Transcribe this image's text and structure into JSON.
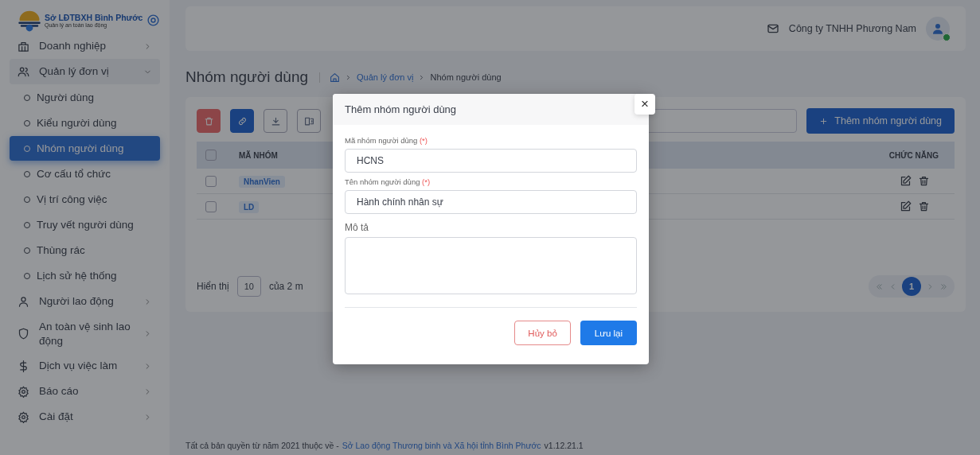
{
  "brand": {
    "title": "Sở LĐTBXH Bình Phước",
    "subtitle": "Quản lý an toàn lao động"
  },
  "sidebar": {
    "items": [
      {
        "label": "Doanh nghiệp",
        "expanded": false
      },
      {
        "label": "Quản lý đơn vị",
        "expanded": true,
        "children": [
          {
            "label": "Người dùng",
            "selected": false
          },
          {
            "label": "Kiểu người dùng",
            "selected": false
          },
          {
            "label": "Nhóm người dùng",
            "selected": true
          },
          {
            "label": "Cơ cấu tổ chức",
            "selected": false
          },
          {
            "label": "Vị trí công việc",
            "selected": false
          },
          {
            "label": "Truy vết người dùng",
            "selected": false
          },
          {
            "label": "Thùng rác",
            "selected": false
          },
          {
            "label": "Lịch sử hệ thống",
            "selected": false
          }
        ]
      },
      {
        "label": "Người lao động",
        "expanded": false
      },
      {
        "label": "An toàn vệ sinh lao động",
        "expanded": false
      },
      {
        "label": "Dịch vụ việc làm",
        "expanded": false
      },
      {
        "label": "Báo cáo",
        "expanded": false
      },
      {
        "label": "Cài đặt",
        "expanded": false
      }
    ]
  },
  "header": {
    "user": "Công ty TNHH Phương Nam"
  },
  "page": {
    "title": "Nhóm người dùng",
    "breadcrumb": [
      "Quản lý đơn vị",
      "Nhóm người dùng"
    ]
  },
  "toolbar": {
    "add_button": "Thêm nhóm người dùng"
  },
  "table": {
    "select_all": false,
    "columns": [
      "MÃ NHÓM",
      "CHỨC NĂNG"
    ],
    "rows": [
      {
        "code": "NhanVien",
        "checked": false
      },
      {
        "code": "LD",
        "checked": false
      }
    ]
  },
  "pager": {
    "show_label": "Hiển thị",
    "page_size": "10",
    "total": "của 2 m",
    "pages": [
      {
        "label": "1",
        "selected": true
      }
    ]
  },
  "footer": {
    "text": "Tất cả bản quyền từ năm 2021 thuộc về - ",
    "link": "Sở Lao động Thương binh và Xã hội tỉnh Bình Phước",
    "version": "v1.12.21.1"
  },
  "modal": {
    "title": "Thêm nhóm người dùng",
    "close": "×",
    "fields": [
      {
        "kind": "input",
        "label": "Mã nhóm người dùng",
        "required": "(*)",
        "value": "HCNS"
      },
      {
        "kind": "input",
        "label": "Tên nhóm người dùng",
        "required": "(*)",
        "value": "Hành chính nhân sự"
      },
      {
        "kind": "textarea",
        "label": "Mô tả"
      }
    ],
    "cancel": "Hủy bỏ",
    "save": "Lưu lại"
  }
}
